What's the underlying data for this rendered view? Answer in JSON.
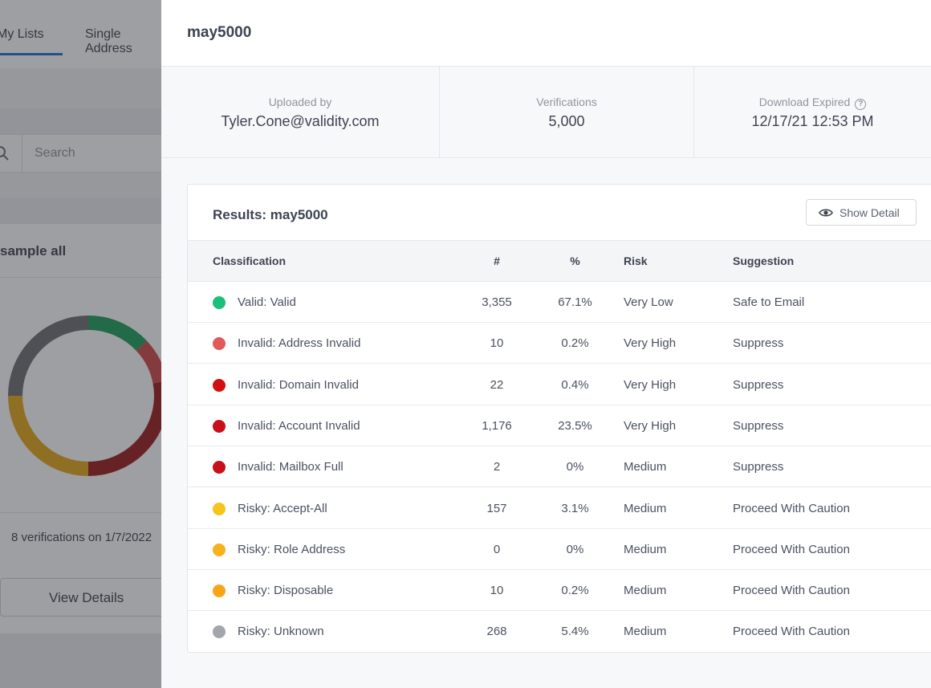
{
  "background": {
    "tabs": [
      {
        "label": "My Lists",
        "active": true
      },
      {
        "label": "Single Address",
        "active": false
      }
    ],
    "search": {
      "placeholder": "Search"
    },
    "card": {
      "title": "sample all",
      "meta": "8 verifications on 1/7/2022",
      "view_details_label": "View Details",
      "donut_segments": [
        {
          "color": "#1f9e5c",
          "fraction": 0.13
        },
        {
          "color": "#cf4a4a",
          "fraction": 0.09
        },
        {
          "color": "#9b1d1d",
          "fraction": 0.28
        },
        {
          "color": "#e3a81a",
          "fraction": 0.25
        },
        {
          "color": "#6d6f73",
          "fraction": 0.25
        }
      ]
    }
  },
  "drawer": {
    "title": "may5000",
    "stats": [
      {
        "label": "Uploaded by",
        "value": "Tyler.Cone@validity.com"
      },
      {
        "label": "Verifications",
        "value": "5,000"
      },
      {
        "label": "Download Expired",
        "value": "12/17/21 12:53 PM",
        "help_icon": "question-circle-icon"
      }
    ],
    "results": {
      "title": "Results: may5000",
      "show_detail_label": "Show Detail",
      "show_detail_icon": "eye-icon",
      "columns": [
        "Classification",
        "#",
        "%",
        "Risk",
        "Suggestion"
      ],
      "rows": [
        {
          "classification": "Valid: Valid",
          "count": "3,355",
          "percent": "67.1%",
          "risk": "Very Low",
          "suggestion": "Safe to Email",
          "color": "#1bbf7a"
        },
        {
          "classification": "Invalid: Address Invalid",
          "count": "10",
          "percent": "0.2%",
          "risk": "Very High",
          "suggestion": "Suppress",
          "color": "#e05a5a"
        },
        {
          "classification": "Invalid: Domain Invalid",
          "count": "22",
          "percent": "0.4%",
          "risk": "Very High",
          "suggestion": "Suppress",
          "color": "#d40f0f"
        },
        {
          "classification": "Invalid: Account Invalid",
          "count": "1,176",
          "percent": "23.5%",
          "risk": "Very High",
          "suggestion": "Suppress",
          "color": "#c8101a"
        },
        {
          "classification": "Invalid: Mailbox Full",
          "count": "2",
          "percent": "0%",
          "risk": "Medium",
          "suggestion": "Suppress",
          "color": "#c8101a"
        },
        {
          "classification": "Risky: Accept-All",
          "count": "157",
          "percent": "3.1%",
          "risk": "Medium",
          "suggestion": "Proceed With Caution",
          "color": "#f7c31d"
        },
        {
          "classification": "Risky: Role Address",
          "count": "0",
          "percent": "0%",
          "risk": "Medium",
          "suggestion": "Proceed With Caution",
          "color": "#f7b11d"
        },
        {
          "classification": "Risky: Disposable",
          "count": "10",
          "percent": "0.2%",
          "risk": "Medium",
          "suggestion": "Proceed With Caution",
          "color": "#f9a51a"
        },
        {
          "classification": "Risky: Unknown",
          "count": "268",
          "percent": "5.4%",
          "risk": "Medium",
          "suggestion": "Proceed With Caution",
          "color": "#a3a7ad"
        }
      ]
    }
  }
}
